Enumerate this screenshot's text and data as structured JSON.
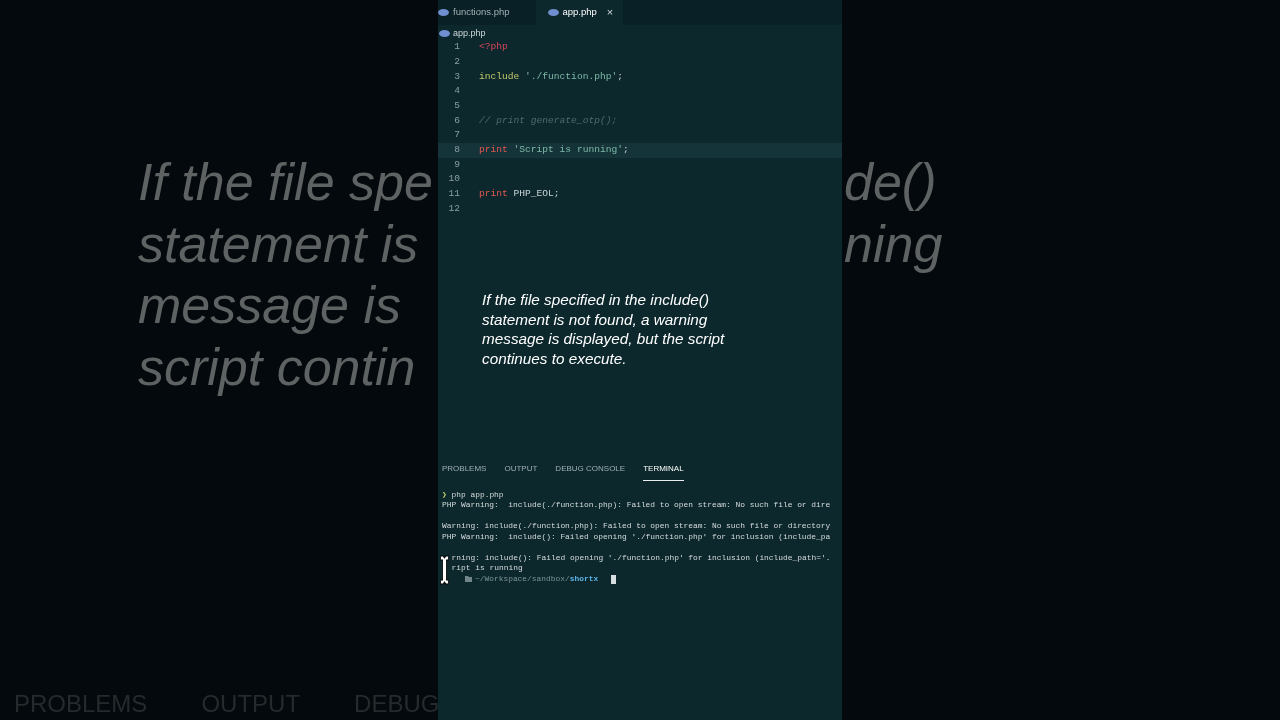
{
  "backdrop": {
    "left_lines": [
      "If the file spe",
      "statement is",
      "message is",
      "script contin"
    ],
    "right_lines": [
      "de()",
      "ning"
    ],
    "panel_tabs": [
      "PROBLEMS",
      "OUTPUT",
      "DEBUG"
    ]
  },
  "editor": {
    "tabs": [
      {
        "label": "functions.php",
        "selected": false
      },
      {
        "label": "app.php",
        "selected": true,
        "close": "×"
      }
    ],
    "breadcrumb": "app.php",
    "lines": [
      {
        "number": "1",
        "highlighted": false,
        "tokens": [
          {
            "kind": "tag",
            "text": "<?php"
          }
        ]
      },
      {
        "number": "2",
        "highlighted": false
      },
      {
        "number": "3",
        "highlighted": false,
        "tokens": [
          {
            "kind": "include",
            "text": "include "
          },
          {
            "kind": "string",
            "text": "'./function.php'"
          },
          {
            "kind": "plain",
            "text": ";"
          }
        ]
      },
      {
        "number": "4",
        "highlighted": false
      },
      {
        "number": "5",
        "highlighted": false
      },
      {
        "number": "6",
        "highlighted": false,
        "tokens": [
          {
            "kind": "comment",
            "text": "// print generate_otp();"
          }
        ]
      },
      {
        "number": "7",
        "highlighted": false
      },
      {
        "number": "8",
        "highlighted": true,
        "tokens": [
          {
            "kind": "keyword",
            "text": "print "
          },
          {
            "kind": "string",
            "text": "'Script is running'"
          },
          {
            "kind": "plain",
            "text": ";"
          }
        ]
      },
      {
        "number": "9",
        "highlighted": false
      },
      {
        "number": "10",
        "highlighted": false
      },
      {
        "number": "11",
        "highlighted": false,
        "tokens": [
          {
            "kind": "keyword",
            "text": "print "
          },
          {
            "kind": "plain",
            "text": "PHP_EOL;"
          }
        ]
      },
      {
        "number": "12",
        "highlighted": false
      }
    ]
  },
  "caption": "If the file specified in the include() statement is not found, a warning message is displayed, but the script continues to execute.",
  "panel": {
    "tabs": [
      {
        "label": "PROBLEMS",
        "selected": false
      },
      {
        "label": "OUTPUT",
        "selected": false
      },
      {
        "label": "DEBUG CONSOLE",
        "selected": false
      },
      {
        "label": "TERMINAL",
        "selected": true
      }
    ],
    "terminal": {
      "lines": [
        {
          "kind": "command",
          "prompt": "❯",
          "text": "php app.php"
        },
        {
          "kind": "output",
          "text": "PHP Warning:  include(./function.php): Failed to open stream: No such file or dire"
        },
        {
          "kind": "blank"
        },
        {
          "kind": "output",
          "text": "Warning: include(./function.php): Failed to open stream: No such file or directory"
        },
        {
          "kind": "output",
          "text": "PHP Warning:  include(): Failed opening './function.php' for inclusion (include_pa"
        },
        {
          "kind": "blank"
        },
        {
          "kind": "covered",
          "text": "rning: include(): Failed opening './function.php' for inclusion (include_path='."
        },
        {
          "kind": "covered",
          "text": "ript is running"
        }
      ],
      "prompt": {
        "path": "~/Workspace/sandbox/",
        "folder": "shortx"
      }
    }
  }
}
